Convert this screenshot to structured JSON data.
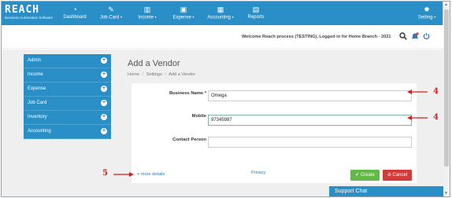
{
  "brand": {
    "name": "REACH",
    "tagline": "Business Automation Software"
  },
  "nav": [
    {
      "label": "Dashboard",
      "icon": "dashboard-icon",
      "glyph": "◔",
      "has_caret": false
    },
    {
      "label": "Job Card",
      "icon": "wrench-icon",
      "glyph": "✎",
      "has_caret": true
    },
    {
      "label": "Income",
      "icon": "bar-chart-icon",
      "glyph": "▥",
      "has_caret": true
    },
    {
      "label": "Expense",
      "icon": "money-icon",
      "glyph": "▣",
      "has_caret": true
    },
    {
      "label": "Accounting",
      "icon": "calculator-icon",
      "glyph": "▦",
      "has_caret": true
    },
    {
      "label": "Reports",
      "icon": "report-icon",
      "glyph": "▤",
      "has_caret": false
    },
    {
      "label": "Setting",
      "icon": "gear-icon",
      "glyph": "✹",
      "has_caret": true
    }
  ],
  "caret": "▾",
  "status": {
    "welcome": "Welcome Reach process (TESTING), Logged in for Home Branch - 2021"
  },
  "sidebar": [
    {
      "label": "Admin"
    },
    {
      "label": "Income"
    },
    {
      "label": "Expense"
    },
    {
      "label": "Job Card"
    },
    {
      "label": "Inventory"
    },
    {
      "label": "Accounting"
    }
  ],
  "plus_glyph": "+",
  "page": {
    "title": "Add a Vendor",
    "breadcrumb": [
      "Home",
      "Settings",
      "Add a Vendor"
    ],
    "breadcrumb_sep": "/"
  },
  "form": {
    "business_name_label": "Business Name *",
    "business_name_value": "Omega",
    "mobile_label": "Mobile",
    "mobile_value": "97345987",
    "contact_person_label": "Contact Person",
    "contact_person_value": "",
    "more_details": "+ more details",
    "privacy": "Privacy",
    "create": "✔ Create",
    "cancel": "⊘ Cancel"
  },
  "support_chat": "Support Chat",
  "annotations": {
    "n1": "4",
    "n2": "4",
    "n3": "5",
    "color": "#d21f1f"
  }
}
